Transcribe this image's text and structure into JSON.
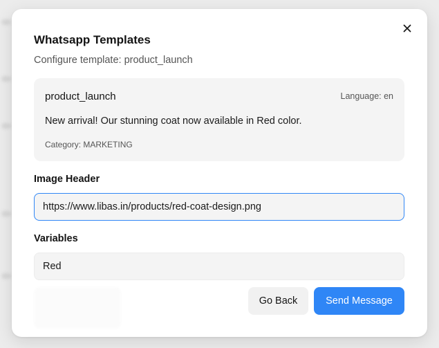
{
  "dialog": {
    "title": "Whatsapp Templates",
    "subtitle": "Configure template: product_launch",
    "close_icon": "close-icon"
  },
  "template_card": {
    "name": "product_launch",
    "language": "Language: en",
    "body": "New arrival! Our stunning coat now available in Red color.",
    "category": "Category: MARKETING"
  },
  "image_header": {
    "label": "Image Header",
    "value": "https://www.libas.in/products/red-coat-design.png"
  },
  "variables": {
    "label": "Variables",
    "value": "Red"
  },
  "actions": {
    "back_label": "Go Back",
    "send_label": "Send Message"
  },
  "colors": {
    "accent": "#2f86f6",
    "card_bg": "#f4f4f4"
  }
}
